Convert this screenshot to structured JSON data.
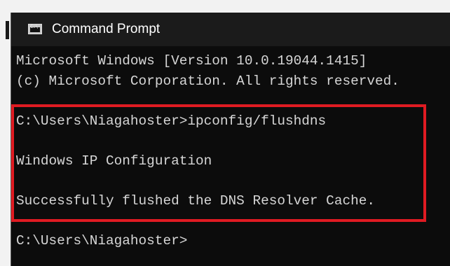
{
  "window": {
    "title": "Command Prompt",
    "icon": "cmd-icon",
    "icon_glyph": "C:\\"
  },
  "terminal": {
    "lines": [
      "Microsoft Windows [Version 10.0.19044.1415]",
      "(c) Microsoft Corporation. All rights reserved.",
      "C:\\Users\\Niagahoster>ipconfig/flushdns",
      "Windows IP Configuration",
      "Successfully flushed the DNS Resolver Cache.",
      "C:\\Users\\Niagahoster>"
    ]
  },
  "colors": {
    "terminal_background": "#0c0c0c",
    "terminal_text": "#d6d6d6",
    "highlight_border": "#e01b22"
  }
}
